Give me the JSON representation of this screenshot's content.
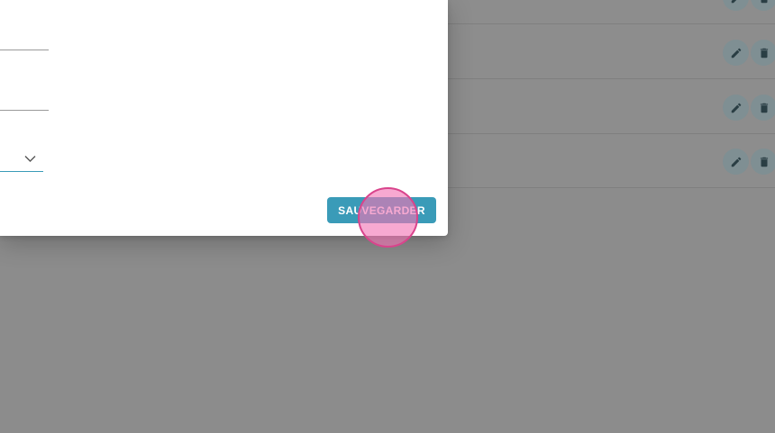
{
  "dialog": {
    "save_label": "SAUVEGARDER"
  },
  "table": {
    "rows": [
      {
        "edit_icon": "pencil-icon",
        "delete_icon": "trash-icon"
      },
      {
        "edit_icon": "pencil-icon",
        "delete_icon": "trash-icon"
      },
      {
        "edit_icon": "pencil-icon",
        "delete_icon": "trash-icon"
      },
      {
        "edit_icon": "pencil-icon",
        "delete_icon": "trash-icon"
      }
    ]
  },
  "colors": {
    "accent": "#3a9bb8",
    "overlay_bg": "#8c8c8c",
    "click_indicator": "#f274b4"
  }
}
